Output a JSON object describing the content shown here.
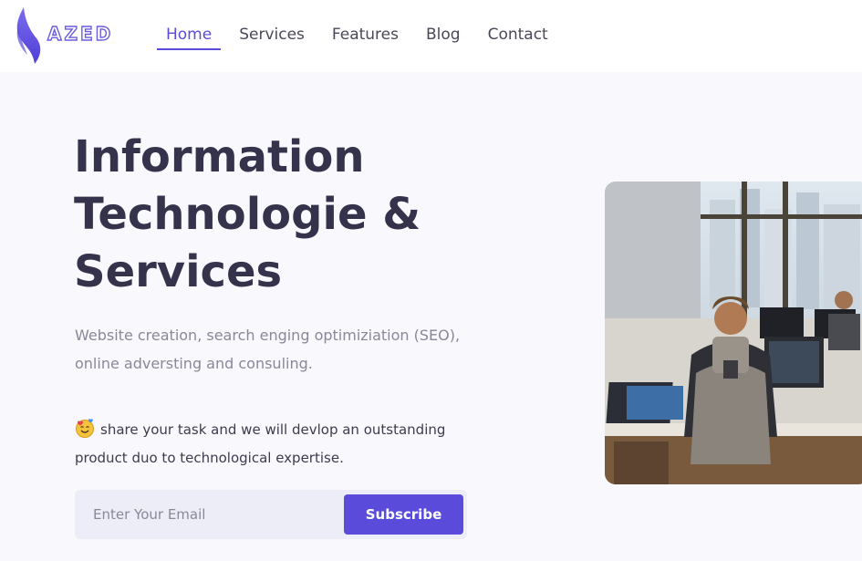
{
  "brand": {
    "name": "AZED",
    "accent": "#5b4bdb"
  },
  "nav": {
    "items": [
      {
        "label": "Home",
        "active": true
      },
      {
        "label": "Services",
        "active": false
      },
      {
        "label": "Features",
        "active": false
      },
      {
        "label": "Blog",
        "active": false
      },
      {
        "label": "Contact",
        "active": false
      }
    ]
  },
  "hero": {
    "title_lines": [
      "Information",
      "Technologie &",
      "Services"
    ],
    "description": "Website creation, search enging optimiziation (SEO), online adversting and consuling.",
    "note_icon": "smiling-face-with-hearts-icon",
    "note": "share your task and we will devlop an outstanding product duo to technological expertise.",
    "email_placeholder": "Enter Your Email",
    "subscribe_label": "Subscribe",
    "image_subject": "office-workers-at-computers-image"
  }
}
